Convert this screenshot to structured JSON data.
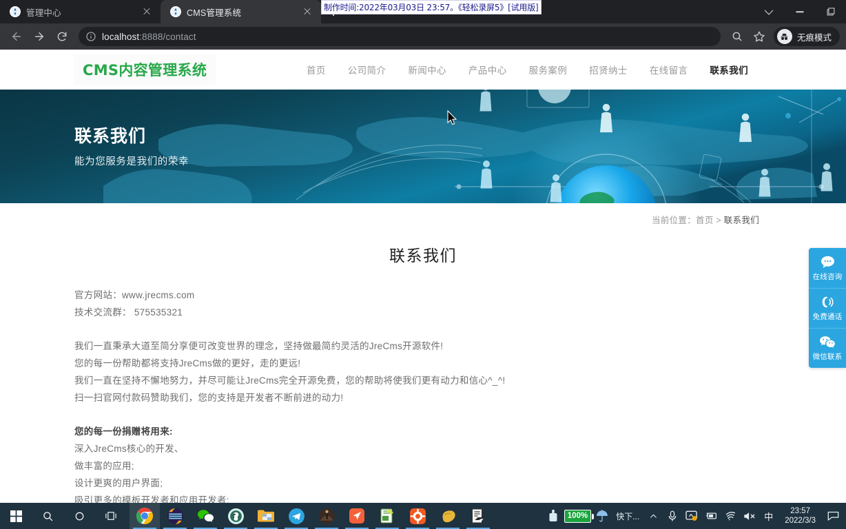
{
  "browser": {
    "tabs": [
      {
        "title": "管理中心",
        "active": false,
        "favicon": "globe-icon"
      },
      {
        "title": "CMS管理系统",
        "active": true,
        "favicon": "globe-icon"
      }
    ],
    "new_tab_label": "+",
    "window_controls": [
      "tab-search-chevron",
      "minimize",
      "restore"
    ],
    "toolbar": {
      "back_label": "←",
      "forward_label": "→",
      "reload_label": "⟳",
      "url_host": "localhost",
      "url_rest": ":8888/contact",
      "url_full": "localhost:8888/contact",
      "search_icon": "search-icon",
      "bookmark_icon": "star-icon",
      "incognito_label": "无痕模式"
    }
  },
  "watermark": {
    "text": "制作时间:2022年03月03日 23:57。《轻松录屏5》[试用版]"
  },
  "site": {
    "logo": "CMS内容管理系统",
    "logo_color": "#27a84a",
    "nav": [
      {
        "label": "首页",
        "active": false
      },
      {
        "label": "公司简介",
        "active": false
      },
      {
        "label": "新闻中心",
        "active": false
      },
      {
        "label": "产品中心",
        "active": false
      },
      {
        "label": "服务案例",
        "active": false
      },
      {
        "label": "招贤纳士",
        "active": false
      },
      {
        "label": "在线留言",
        "active": false
      },
      {
        "label": "联系我们",
        "active": true
      }
    ],
    "hero": {
      "title": "联系我们",
      "subtitle": "能为您服务是我们的荣幸"
    },
    "breadcrumb": {
      "prefix": "当前位置：",
      "home": "首页",
      "sep": " > ",
      "current": "联系我们"
    },
    "article": {
      "title": "联系我们",
      "lines": [
        {
          "text": "官方网站：www.jrecms.com",
          "style": "normal"
        },
        {
          "text": "技术交流群：  575535321",
          "style": "normal"
        },
        {
          "text": "",
          "style": "spacer"
        },
        {
          "text": "我们一直秉承大道至简分享便可改变世界的理念，坚持做最简约灵活的JreCms开源软件!",
          "style": "normal"
        },
        {
          "text": "您的每一份帮助都将支持JreCms做的更好，走的更远!",
          "style": "normal"
        },
        {
          "text": "我们一直在坚持不懈地努力，并尽可能让JreCms完全开源免费，您的帮助将使我们更有动力和信心^_^!",
          "style": "normal"
        },
        {
          "text": "扫一扫官网付款码赞助我们，您的支持是开发者不断前进的动力!",
          "style": "normal"
        },
        {
          "text": "",
          "style": "spacer"
        },
        {
          "text": "您的每一份捐赠将用来:",
          "style": "strong"
        },
        {
          "text": "深入JreCms核心的开发、",
          "style": "normal"
        },
        {
          "text": "做丰富的应用;",
          "style": "normal"
        },
        {
          "text": "设计更爽的用户界面;",
          "style": "normal"
        },
        {
          "text": "吸引更多的模板开发者和应用开发者;",
          "style": "normal"
        }
      ]
    },
    "side_service": {
      "accent": "#2ba6e0",
      "items": [
        {
          "label": "在线咨询",
          "icon": "chat-bubble-icon"
        },
        {
          "label": "免费通话",
          "icon": "phone-call-icon"
        },
        {
          "label": "微信联系",
          "icon": "wechat-icon"
        }
      ]
    }
  },
  "taskbar": {
    "start_label": "start-icon",
    "search_label": "search-icon",
    "cortana_label": "cortana-icon",
    "taskview_label": "task-view-icon",
    "apps": [
      {
        "name": "chrome-taskbar-icon",
        "running": true,
        "focused": true
      },
      {
        "name": "editor-taskbar-icon",
        "running": true,
        "focused": false
      },
      {
        "name": "wechat-taskbar-icon",
        "running": true,
        "focused": false
      },
      {
        "name": "browser-taskbar-icon",
        "running": true,
        "focused": false
      },
      {
        "name": "file-explorer-taskbar-icon",
        "running": true,
        "focused": false
      },
      {
        "name": "telegram-taskbar-icon",
        "running": true,
        "focused": false
      },
      {
        "name": "idea-taskbar-icon",
        "running": true,
        "focused": false
      },
      {
        "name": "navigation-taskbar-icon",
        "running": true,
        "focused": false
      },
      {
        "name": "notes-taskbar-icon",
        "running": true,
        "focused": false
      },
      {
        "name": "settings-taskbar-icon",
        "running": true,
        "focused": false
      },
      {
        "name": "potato-taskbar-icon",
        "running": true,
        "focused": false
      },
      {
        "name": "pdf-taskbar-icon",
        "running": true,
        "focused": false
      }
    ],
    "tray": {
      "battery_percent": "100%",
      "weather_label": "快下...",
      "ime_label": "中",
      "icons": [
        "show-hidden-icons-chevron",
        "microphone-icon",
        "screen-capture-icon",
        "battery-icon",
        "wifi-icon",
        "volume-muted-icon"
      ],
      "time": "23:57",
      "date": "2022/3/3",
      "notification_icon": "notification-icon"
    }
  }
}
